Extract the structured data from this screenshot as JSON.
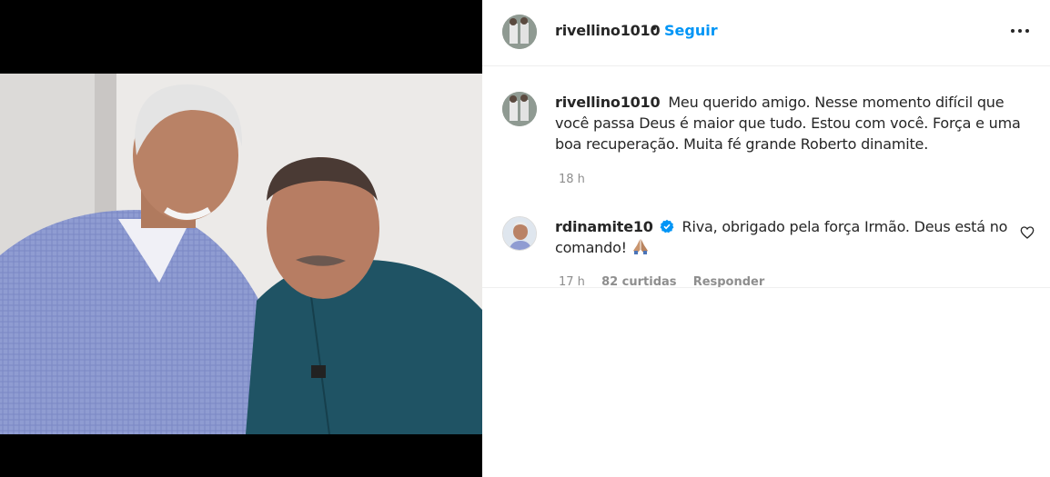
{
  "post": {
    "author": "rivellino1010",
    "separator": "•",
    "follow_label": "Seguir",
    "more_icon": "more-options-icon"
  },
  "caption": {
    "username": "rivellino1010",
    "text": "Meu querido amigo. Nesse momento difícil que você passa Deus é maior que tudo. Estou com você. Força e uma boa recuperação. Muita fé grande Roberto dinamite.",
    "time": "18 h"
  },
  "reply": {
    "username": "rdinamite10",
    "verified_icon": "verified-badge-icon",
    "text": "Riva, obrigado pela força Irmão. Deus está no comando!",
    "emoji_icon": "folded-hands-icon",
    "time": "17 h",
    "likes": "82 curtidas",
    "reply_label": "Responder",
    "like_icon": "heart-icon"
  },
  "colors": {
    "accent": "#0095f6",
    "text": "#262626",
    "muted": "#8e8e8e",
    "media_background": "#000000"
  }
}
